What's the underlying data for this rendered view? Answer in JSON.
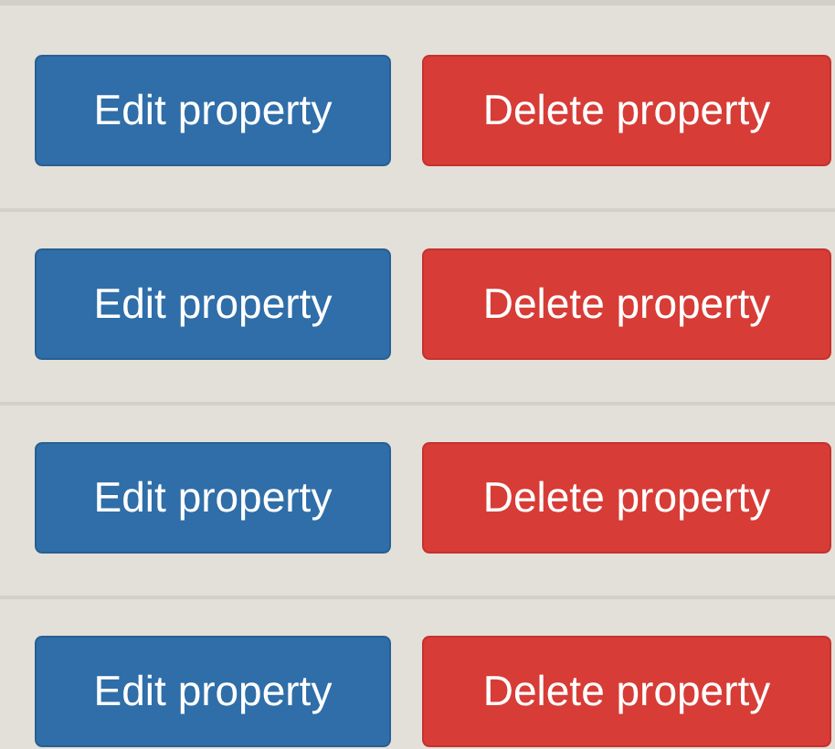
{
  "rows": [
    {
      "buttons": [
        {
          "label": "Edit property",
          "kind": "edit"
        },
        {
          "label": "Delete property",
          "kind": "delete"
        }
      ]
    },
    {
      "buttons": [
        {
          "label": "Edit property",
          "kind": "edit"
        },
        {
          "label": "Delete property",
          "kind": "delete"
        }
      ]
    },
    {
      "buttons": [
        {
          "label": "Edit property",
          "kind": "edit"
        },
        {
          "label": "Delete property",
          "kind": "delete"
        }
      ]
    },
    {
      "buttons": [
        {
          "label": "Edit property",
          "kind": "edit"
        },
        {
          "label": "Delete property",
          "kind": "delete"
        }
      ]
    }
  ]
}
